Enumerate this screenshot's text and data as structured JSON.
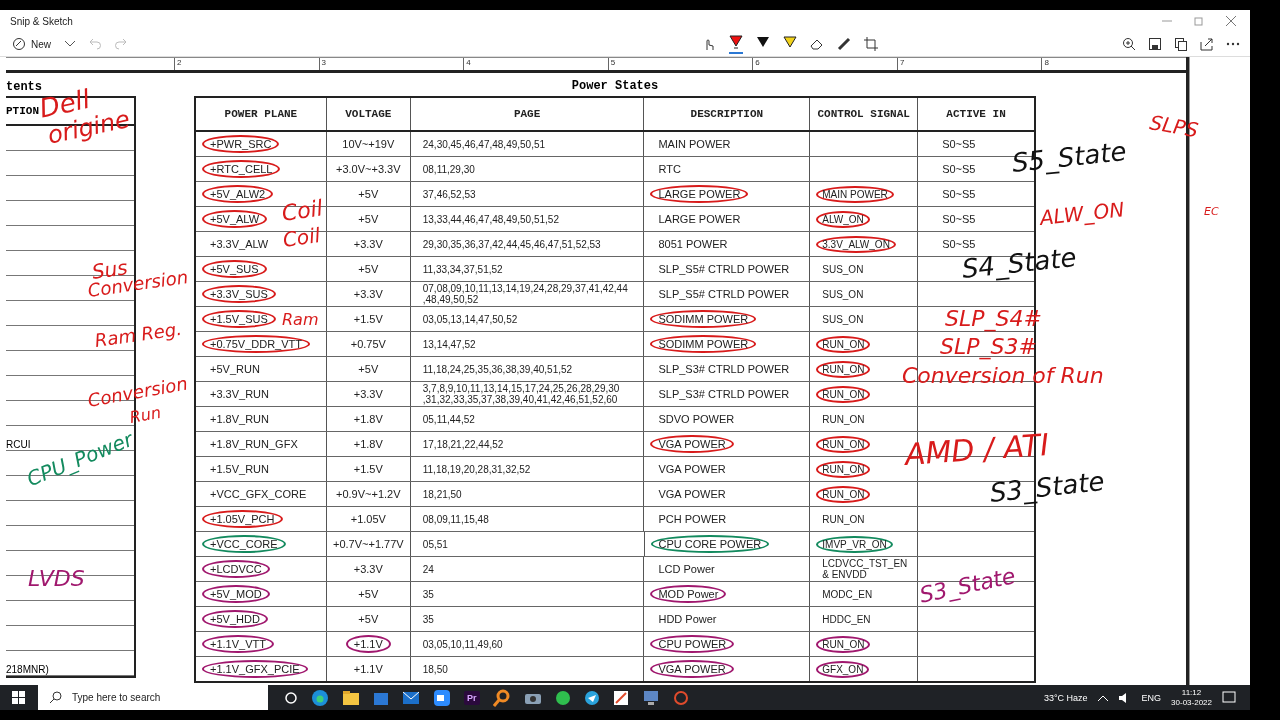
{
  "window": {
    "title": "Snip & Sketch"
  },
  "toolbar": {
    "new_label": "New"
  },
  "ruler": [
    "2",
    "3",
    "4",
    "5",
    "6",
    "7",
    "8"
  ],
  "side_table": {
    "title": "tents",
    "column": "PTION",
    "notes": [
      "RCUI",
      "218MNR)"
    ]
  },
  "table": {
    "title": "Power States",
    "columns": [
      "POWER PLANE",
      "VOLTAGE",
      "PAGE",
      "DESCRIPTION",
      "CONTROL SIGNAL",
      "ACTIVE IN"
    ],
    "rows": [
      {
        "plane": {
          "text": "+PWR_SRC",
          "color": "#d81b1b"
        },
        "voltage": {
          "text": "10V~+19V"
        },
        "page": "24,30,45,46,47,48,49,50,51",
        "description": {
          "text": "MAIN POWER"
        },
        "active": "S0~S5"
      },
      {
        "plane": {
          "text": "+RTC_CELL",
          "color": "#d81b1b"
        },
        "voltage": {
          "text": "+3.0V~+3.3V"
        },
        "page": "08,11,29,30",
        "description": {
          "text": "RTC"
        },
        "active": "S0~S5"
      },
      {
        "plane": {
          "text": "+5V_ALW2",
          "color": "#d81b1b"
        },
        "voltage": {
          "text": "+5V"
        },
        "page": "37,46,52,53",
        "description": {
          "text": "LARGE  POWER",
          "color": "#d81b1b"
        },
        "signal": {
          "text": "MAIN POWER",
          "color": "#d81b1b"
        },
        "active": "S0~S5"
      },
      {
        "plane": {
          "text": "+5V_ALW",
          "color": "#d81b1b"
        },
        "voltage": {
          "text": "+5V"
        },
        "page": "13,33,44,46,47,48,49,50,51,52",
        "description": {
          "text": "LARGE  POWER"
        },
        "signal": {
          "text": "ALW_ON",
          "color": "#d81b1b"
        },
        "active": "S0~S5"
      },
      {
        "plane": {
          "text": "+3.3V_ALW"
        },
        "voltage": {
          "text": "+3.3V"
        },
        "page": "29,30,35,36,37,42,44,45,46,47,51,52,53",
        "description": {
          "text": "8051 POWER"
        },
        "signal": {
          "text": "3.3V_ALW_ON",
          "color": "#d81b1b"
        },
        "active": "S0~S5"
      },
      {
        "plane": {
          "text": "+5V_SUS",
          "color": "#d81b1b"
        },
        "voltage": {
          "text": "+5V"
        },
        "page": "11,33,34,37,51,52",
        "description": {
          "text": "SLP_S5# CTRLD POWER"
        },
        "signal": {
          "text": "SUS_ON"
        }
      },
      {
        "plane": {
          "text": "+3.3V_SUS",
          "color": "#d81b1b"
        },
        "voltage": {
          "text": "+3.3V"
        },
        "page": "07,08,09,10,11,13,14,19,24,28,29,37,41,42,44\n,48,49,50,52",
        "description": {
          "text": "SLP_S5# CTRLD POWER"
        },
        "signal": {
          "text": "SUS_ON"
        }
      },
      {
        "plane": {
          "text": "+1.5V_SUS",
          "color": "#d81b1b"
        },
        "voltage": {
          "text": "+1.5V"
        },
        "page": "03,05,13,14,47,50,52",
        "description": {
          "text": "SODIMM POWER",
          "color": "#d81b1b"
        },
        "signal": {
          "text": "SUS_ON"
        }
      },
      {
        "plane": {
          "text": "+0.75V_DDR_VTT",
          "color": "#d81b1b"
        },
        "voltage": {
          "text": "+0.75V"
        },
        "page": "13,14,47,52",
        "description": {
          "text": "SODIMM POWER",
          "color": "#d81b1b"
        },
        "signal": {
          "text": "RUN_ON",
          "color": "#d81b1b"
        }
      },
      {
        "plane": {
          "text": "+5V_RUN"
        },
        "voltage": {
          "text": "+5V"
        },
        "page": "11,18,24,25,35,36,38,39,40,51,52",
        "description": {
          "text": "SLP_S3# CTRLD POWER"
        },
        "signal": {
          "text": "RUN_ON",
          "color": "#d81b1b"
        }
      },
      {
        "plane": {
          "text": "+3.3V_RUN"
        },
        "voltage": {
          "text": "+3.3V"
        },
        "page": "3,7,8,9,10,11,13,14,15,17,24,25,26,28,29,30\n,31,32,33,35,37,38,39,40,41,42,46,51,52,60",
        "description": {
          "text": "SLP_S3# CTRLD POWER"
        },
        "signal": {
          "text": "RUN_ON",
          "color": "#d81b1b"
        }
      },
      {
        "plane": {
          "text": "+1.8V_RUN"
        },
        "voltage": {
          "text": "+1.8V"
        },
        "page": "05,11,44,52",
        "description": {
          "text": "SDVO POWER"
        },
        "signal": {
          "text": "RUN_ON"
        }
      },
      {
        "plane": {
          "text": "+1.8V_RUN_GFX"
        },
        "voltage": {
          "text": "+1.8V"
        },
        "page": "17,18,21,22,44,52",
        "description": {
          "text": "VGA POWER",
          "color": "#d81b1b"
        },
        "signal": {
          "text": "RUN_ON",
          "color": "#d81b1b"
        }
      },
      {
        "plane": {
          "text": "+1.5V_RUN"
        },
        "voltage": {
          "text": "+1.5V"
        },
        "page": "11,18,19,20,28,31,32,52",
        "description": {
          "text": "VGA POWER"
        },
        "signal": {
          "text": "RUN_ON",
          "color": "#d81b1b"
        }
      },
      {
        "plane": {
          "text": "+VCC_GFX_CORE"
        },
        "voltage": {
          "text": "+0.9V~+1.2V"
        },
        "page": "18,21,50",
        "description": {
          "text": "VGA POWER"
        },
        "signal": {
          "text": "RUN_ON",
          "color": "#d81b1b"
        }
      },
      {
        "plane": {
          "text": "+1.05V_PCH",
          "color": "#d81b1b"
        },
        "voltage": {
          "text": "+1.05V"
        },
        "page": "08,09,11,15,48",
        "description": {
          "text": "PCH POWER"
        },
        "signal": {
          "text": "RUN_ON"
        }
      },
      {
        "plane": {
          "text": "+VCC_CORE",
          "color": "#138a5e"
        },
        "voltage": {
          "text": "+0.7V~+1.77V"
        },
        "page": "05,51",
        "description": {
          "text": "CPU CORE POWER",
          "color": "#138a5e"
        },
        "signal": {
          "text": "IMVP_VR_ON",
          "color": "#138a5e"
        }
      },
      {
        "plane": {
          "text": "+LCDVCC",
          "color": "#a0186e"
        },
        "voltage": {
          "text": "+3.3V"
        },
        "page": "24",
        "description": {
          "text": "LCD Power"
        },
        "signal": {
          "text": "LCDVCC_TST_EN\n& ENVDD"
        }
      },
      {
        "plane": {
          "text": "+5V_MOD",
          "color": "#a0186e"
        },
        "voltage": {
          "text": "+5V"
        },
        "page": "35",
        "description": {
          "text": "MOD Power",
          "color": "#a0186e"
        },
        "signal": {
          "text": "MODC_EN"
        }
      },
      {
        "plane": {
          "text": "+5V_HDD",
          "color": "#a0186e"
        },
        "voltage": {
          "text": "+5V"
        },
        "page": "35",
        "description": {
          "text": "HDD Power"
        },
        "signal": {
          "text": "HDDC_EN"
        }
      },
      {
        "plane": {
          "text": "+1.1V_VTT",
          "color": "#a0186e"
        },
        "voltage": {
          "text": "+1.1V",
          "color": "#a0186e"
        },
        "page": "03,05,10,11,49,60",
        "description": {
          "text": "CPU POWER",
          "color": "#a0186e"
        },
        "signal": {
          "text": "RUN_ON",
          "color": "#a0186e"
        }
      },
      {
        "plane": {
          "text": "+1.1V_GFX_PCIE",
          "color": "#a0186e"
        },
        "voltage": {
          "text": "+1.1V"
        },
        "page": "18,50",
        "description": {
          "text": "VGA POWER",
          "color": "#a0186e"
        },
        "signal": {
          "text": "GFX_ON",
          "color": "#a0186e"
        }
      }
    ]
  },
  "annotations": [
    {
      "text": "Dell",
      "color": "#d81b1b"
    },
    {
      "text": "origine",
      "color": "#d81b1b"
    },
    {
      "text": "Coil",
      "color": "#d81b1b"
    },
    {
      "text": "Coil",
      "color": "#d81b1b"
    },
    {
      "text": "Sus",
      "color": "#d81b1b"
    },
    {
      "text": "Conversion",
      "color": "#d81b1b"
    },
    {
      "text": "Ram",
      "color": "#d81b1b"
    },
    {
      "text": "Ram Reg.",
      "color": "#d81b1b"
    },
    {
      "text": "Conversion",
      "color": "#d81b1b"
    },
    {
      "text": "Run",
      "color": "#d81b1b"
    },
    {
      "text": "CPU_Power",
      "color": "#138a5e"
    },
    {
      "text": "LVDS",
      "color": "#a0186e"
    },
    {
      "text": "S5_State",
      "color": "#111111"
    },
    {
      "text": "S4_State",
      "color": "#111111"
    },
    {
      "text": "SLP_S4#",
      "color": "#d81b1b"
    },
    {
      "text": "SLP_S3#",
      "color": "#d81b1b"
    },
    {
      "text": "Conversion of Run",
      "color": "#d81b1b"
    },
    {
      "text": "AMD / ATI",
      "color": "#d81b1b"
    },
    {
      "text": "S3_State",
      "color": "#111111"
    },
    {
      "text": "S3_State",
      "color": "#a0186e"
    },
    {
      "text": "SLPS",
      "color": "#d81b1b"
    },
    {
      "text": "ALW_ON",
      "color": "#d81b1b"
    },
    {
      "text": "EC",
      "color": "#d81b1b"
    }
  ],
  "taskbar": {
    "search_placeholder": "Type here to search",
    "app_label": "Pr",
    "weather": "33°C  Haze",
    "language": "ENG",
    "time": "11:12",
    "date": "30-03-2022"
  }
}
